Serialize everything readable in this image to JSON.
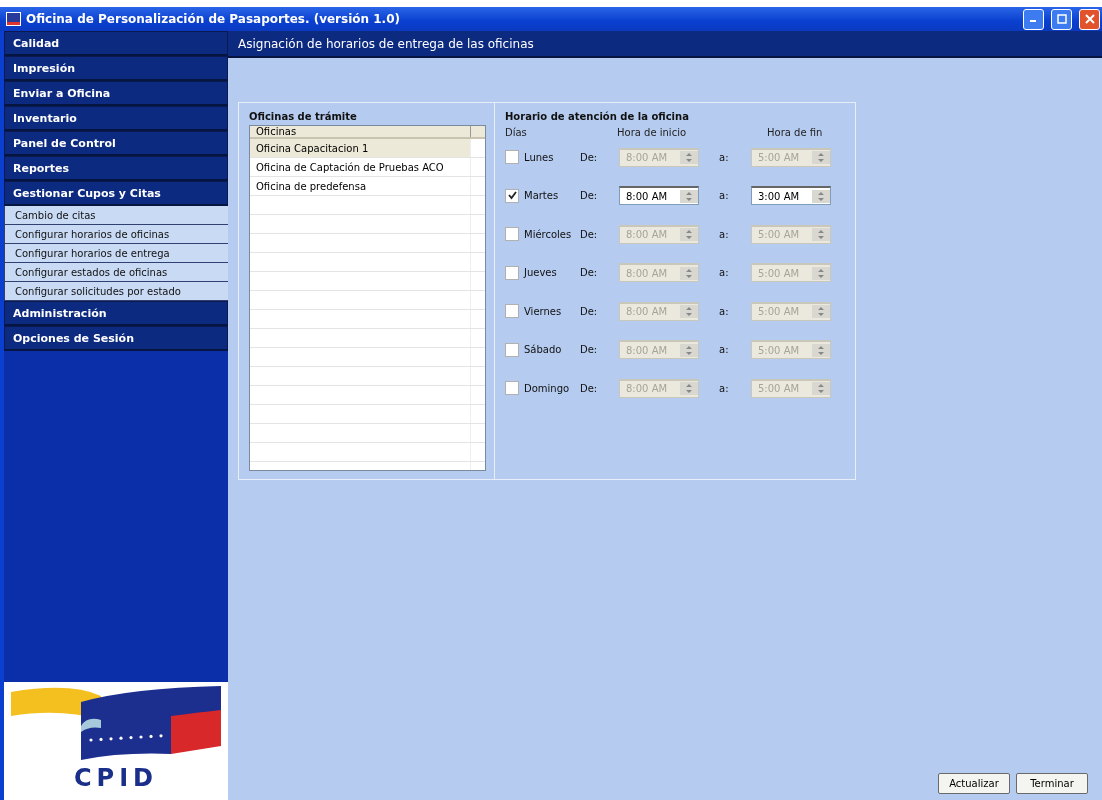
{
  "window": {
    "title": "Oficina de Personalización de Pasaportes. (versión 1.0)"
  },
  "sidebar": {
    "items": [
      {
        "label": "Calidad"
      },
      {
        "label": "Impresión"
      },
      {
        "label": "Enviar a Oficina"
      },
      {
        "label": "Inventario"
      },
      {
        "label": "Panel de Control"
      },
      {
        "label": "Reportes"
      },
      {
        "label": "Gestionar Cupos y Citas",
        "children": [
          {
            "label": "Cambio de citas"
          },
          {
            "label": "Configurar horarios de oficinas"
          },
          {
            "label": "Configurar horarios de entrega"
          },
          {
            "label": "Configurar estados de oficinas"
          },
          {
            "label": "Configurar solicitudes por estado"
          }
        ]
      },
      {
        "label": "Administración"
      },
      {
        "label": "Opciones de Sesión"
      }
    ],
    "logo": "CPID"
  },
  "page_title": "Asignación de horarios de entrega de las oficinas",
  "offices": {
    "title": "Oficinas de trámite",
    "column": "Oficinas",
    "rows": [
      {
        "name": "Oficina Capacitacion 1",
        "selected": true
      },
      {
        "name": "Oficina de Captación de Pruebas ACO",
        "selected": false
      },
      {
        "name": "Oficina de predefensa",
        "selected": false
      }
    ]
  },
  "schedule": {
    "title": "Horario de atención de la oficina",
    "headers": {
      "days": "Días",
      "start": "Hora de inicio",
      "end": "Hora de fin"
    },
    "days": [
      {
        "name": "Lunes",
        "checked": false,
        "from_label": "De:",
        "start": "8:00 AM",
        "to_label": "a:",
        "end": "5:00 AM"
      },
      {
        "name": "Martes",
        "checked": true,
        "from_label": "De:",
        "start": "8:00 AM",
        "to_label": "a:",
        "end": "3:00 AM"
      },
      {
        "name": "Miércoles",
        "checked": false,
        "from_label": "De:",
        "start": "8:00 AM",
        "to_label": "a:",
        "end": "5:00 AM"
      },
      {
        "name": "Jueves",
        "checked": false,
        "from_label": "De:",
        "start": "8:00 AM",
        "to_label": "a:",
        "end": "5:00 AM"
      },
      {
        "name": "Viernes",
        "checked": false,
        "from_label": "De:",
        "start": "8:00 AM",
        "to_label": "a:",
        "end": "5:00 AM"
      },
      {
        "name": "Sábado",
        "checked": false,
        "from_label": "De:",
        "start": "8:00 AM",
        "to_label": "a:",
        "end": "5:00 AM"
      },
      {
        "name": "Domingo",
        "checked": false,
        "from_label": "De:",
        "start": "8:00 AM",
        "to_label": "a:",
        "end": "5:00 AM"
      }
    ]
  },
  "buttons": [
    "Actualizar",
    "Terminar"
  ]
}
